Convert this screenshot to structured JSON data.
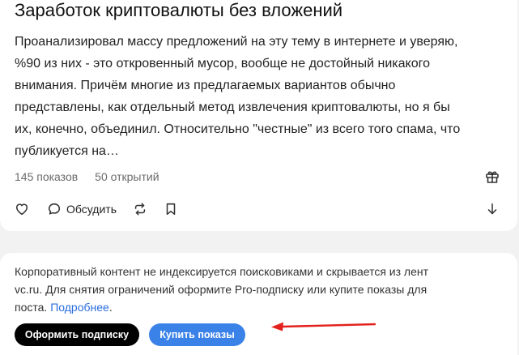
{
  "post": {
    "title": "Заработок криптовалюты без вложений",
    "excerpt_lines": [
      "Проанализировал массу предложений на эту тему в интернете и уверяю,",
      "%90 из них - это откровенный мусор, вообще не достойный никакого",
      "внимания. Причём многие из предлагаемых вариантов обычно",
      "представлены, как отдельный метод извлечения криптовалюты, но я бы",
      "их, конечно, объединил. Относительно \"честные\" из всего того спама, что",
      "публикуется на…"
    ],
    "views": "145 показов",
    "opens": "50 открытий",
    "comment_label": "Обсудить"
  },
  "notice": {
    "line1": "Корпоративный контент не индексируется поисковиками и скрывается из лент",
    "line2": "vc.ru. Для снятия ограничений оформите Pro-подписку или купите показы для",
    "line3_text": "поста.",
    "link": "Подробнее",
    "line3_end": "."
  },
  "buttons": {
    "subscribe": "Оформить подписку",
    "buy": "Купить показы"
  },
  "colors": {
    "accent": "#3b82e8",
    "link": "#2b6ede",
    "annotation_arrow": "#e3211c"
  },
  "icons": [
    "gift-icon",
    "heart-icon",
    "comment-icon",
    "repost-icon",
    "bookmark-icon",
    "arrow-down-icon",
    "red-arrow-annotation"
  ]
}
